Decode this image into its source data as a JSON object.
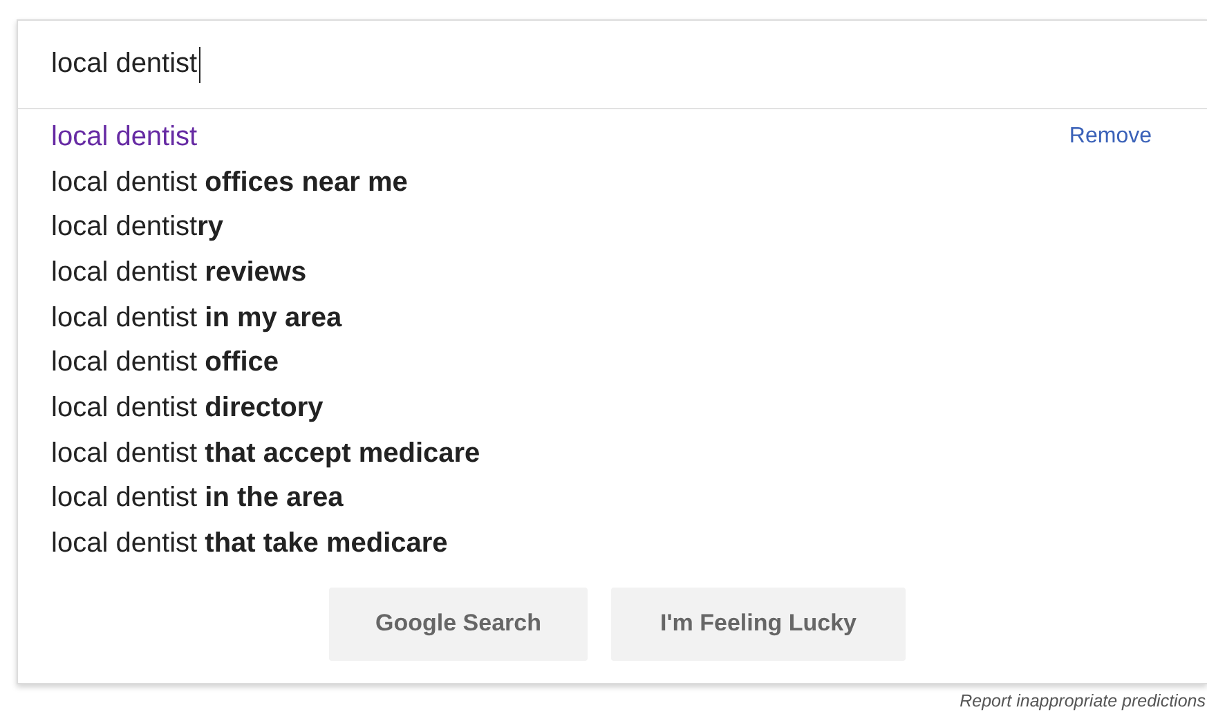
{
  "search": {
    "value": "local dentist",
    "focused": true
  },
  "suggestions": [
    {
      "text": "local dentist",
      "visited": true,
      "action": "Remove"
    },
    {
      "text": "local dentist **offices near me**",
      "visited": false
    },
    {
      "text": "local dentist**ry**",
      "visited": false
    },
    {
      "text": "local dentist **reviews**",
      "visited": false
    },
    {
      "text": "local dentist **in my area**",
      "visited": false
    },
    {
      "text": "local dentist **office**",
      "visited": false
    },
    {
      "text": "local dentist **directory**",
      "visited": false
    },
    {
      "text": "local dentist **that accept medicare**",
      "visited": false
    },
    {
      "text": "local dentist **in the area**",
      "visited": false
    },
    {
      "text": "local dentist **that take medicare**",
      "visited": false
    }
  ],
  "buttons": [
    "Google Search",
    "I'm Feeling Lucky"
  ],
  "footer_link": "Report inappropriate predictions"
}
